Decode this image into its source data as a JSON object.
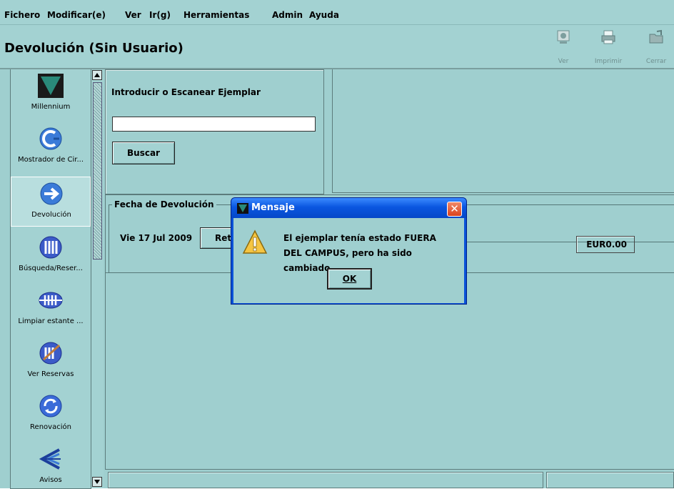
{
  "menu": {
    "items": [
      {
        "label": "Fichero",
        "u": "F"
      },
      {
        "label": "Modificar(e)"
      },
      {
        "label": "Ver",
        "u": "V"
      },
      {
        "label": "Ir(g)"
      },
      {
        "label": "Herramientas"
      },
      {
        "label": "Admin",
        "u": "A"
      },
      {
        "label": "Ayuda"
      }
    ]
  },
  "header": {
    "title": "Devolución (Sin Usuario)",
    "toolbar": {
      "ver": "Ver",
      "imprimir": "Imprimir",
      "cerrar": "Cerrar"
    }
  },
  "sidebar": {
    "items": [
      {
        "label": "Millennium",
        "icon": "millennium-logo-icon"
      },
      {
        "label": "Mostrador de Cir...",
        "icon": "circulation-desk-icon"
      },
      {
        "label": "Devolución",
        "icon": "return-arrow-icon",
        "selected": true
      },
      {
        "label": "Búsqueda/Reser...",
        "icon": "search-hold-icon"
      },
      {
        "label": "Limpiar estante ...",
        "icon": "clear-shelf-icon"
      },
      {
        "label": "Ver Reservas",
        "icon": "view-holds-icon"
      },
      {
        "label": "Renovación",
        "icon": "renewal-icon"
      },
      {
        "label": "Avisos",
        "icon": "notices-icon"
      }
    ]
  },
  "scan": {
    "label": "Introducir o Escanear Ejemplar",
    "input_value": "",
    "search_button": "Buscar"
  },
  "return_date": {
    "legend": "Fecha de Devolución",
    "date": "Vie 17 Jul 2009",
    "button_visible": "Retr",
    "amount": "EUR0.00"
  },
  "dialog": {
    "title": "Mensaje",
    "message": "El ejemplar tenía estado FUERA DEL CAMPUS, pero ha sido cambiado.",
    "ok": "OK"
  },
  "colors": {
    "background": "#9fcfcf",
    "dialog_title": "#0a52d8",
    "close_button": "#d9421e"
  }
}
